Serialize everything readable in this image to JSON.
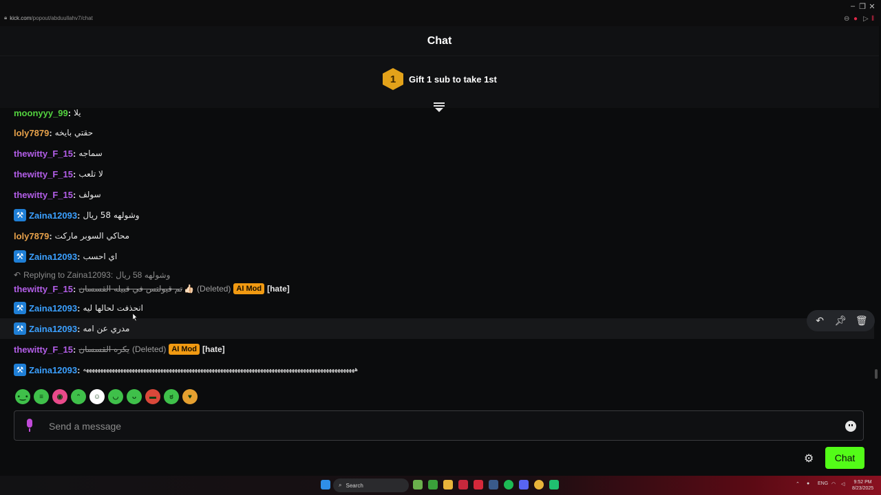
{
  "browser": {
    "url_host": "kick.com",
    "url_path": "/popout/abduullahv7/chat"
  },
  "header": {
    "title": "Chat"
  },
  "gift": {
    "badge_number": "1",
    "text": "Gift 1 sub to take 1st"
  },
  "messages": [
    {
      "user": "moonyyy_99",
      "color": "green",
      "text": "يلا",
      "mod": false,
      "partial": true
    },
    {
      "user": "loly7879",
      "color": "orange",
      "text": "حقتي بايخه",
      "mod": false
    },
    {
      "user": "thewitty_F_15",
      "color": "purple",
      "text": "سماجه",
      "mod": false
    },
    {
      "user": "thewitty_F_15",
      "color": "purple",
      "text": "لا تلعب",
      "mod": false
    },
    {
      "user": "thewitty_F_15",
      "color": "purple",
      "text": "سولف",
      "mod": false
    },
    {
      "user": "Zaina12093",
      "color": "blue",
      "text": "وشولهه 58 ريال",
      "mod": true
    },
    {
      "user": "loly7879",
      "color": "orange",
      "text": "محاكي السوبر ماركت",
      "mod": false
    },
    {
      "user": "Zaina12093",
      "color": "blue",
      "text": "اي احسب",
      "mod": true
    },
    {
      "user": "thewitty_F_15",
      "color": "purple",
      "text": "تم قيولتس في قبيله القسسان",
      "mod": false,
      "deleted": true,
      "thumb": true
    },
    {
      "user": "Zaina12093",
      "color": "blue",
      "text": "انحذفت لحالها ليه",
      "mod": true
    },
    {
      "user": "Zaina12093",
      "color": "blue",
      "text": "مدري عن امه",
      "mod": true
    },
    {
      "user": "thewitty_F_15",
      "color": "purple",
      "text": "يكره القسسان",
      "mod": false,
      "deleted": true
    },
    {
      "user": "Zaina12093",
      "color": "blue",
      "text": "هههههههههههههههههههههههههههههههههههههههههههههههههههههههههههههههههههههههههههههههههههههههههههههههه",
      "mod": true
    }
  ],
  "reply": {
    "label": "Replying to Zaina12093:",
    "quoted": "وشولهه 58 ريال"
  },
  "tags": {
    "deleted": "(Deleted)",
    "ai_mod": "AI Mod",
    "reason": "[hate]"
  },
  "composer": {
    "placeholder": "Send a message"
  },
  "send_button": {
    "label": "Chat"
  },
  "taskbar": {
    "search": "Search",
    "lang": "ENG",
    "time": "9:52 PM",
    "date": "8/23/2025"
  },
  "colors": {
    "brand_green": "#53fc18",
    "ai_mod": "#f19a12",
    "mod_badge": "#1f7fd6"
  },
  "icons": [
    "lock-icon",
    "zoom-icon",
    "shield-icon",
    "collapse-icon",
    "reply-icon",
    "pin-icon",
    "trash-icon",
    "mic-icon",
    "emoji-icon",
    "gear-icon",
    "windows-icon",
    "search-icon"
  ]
}
